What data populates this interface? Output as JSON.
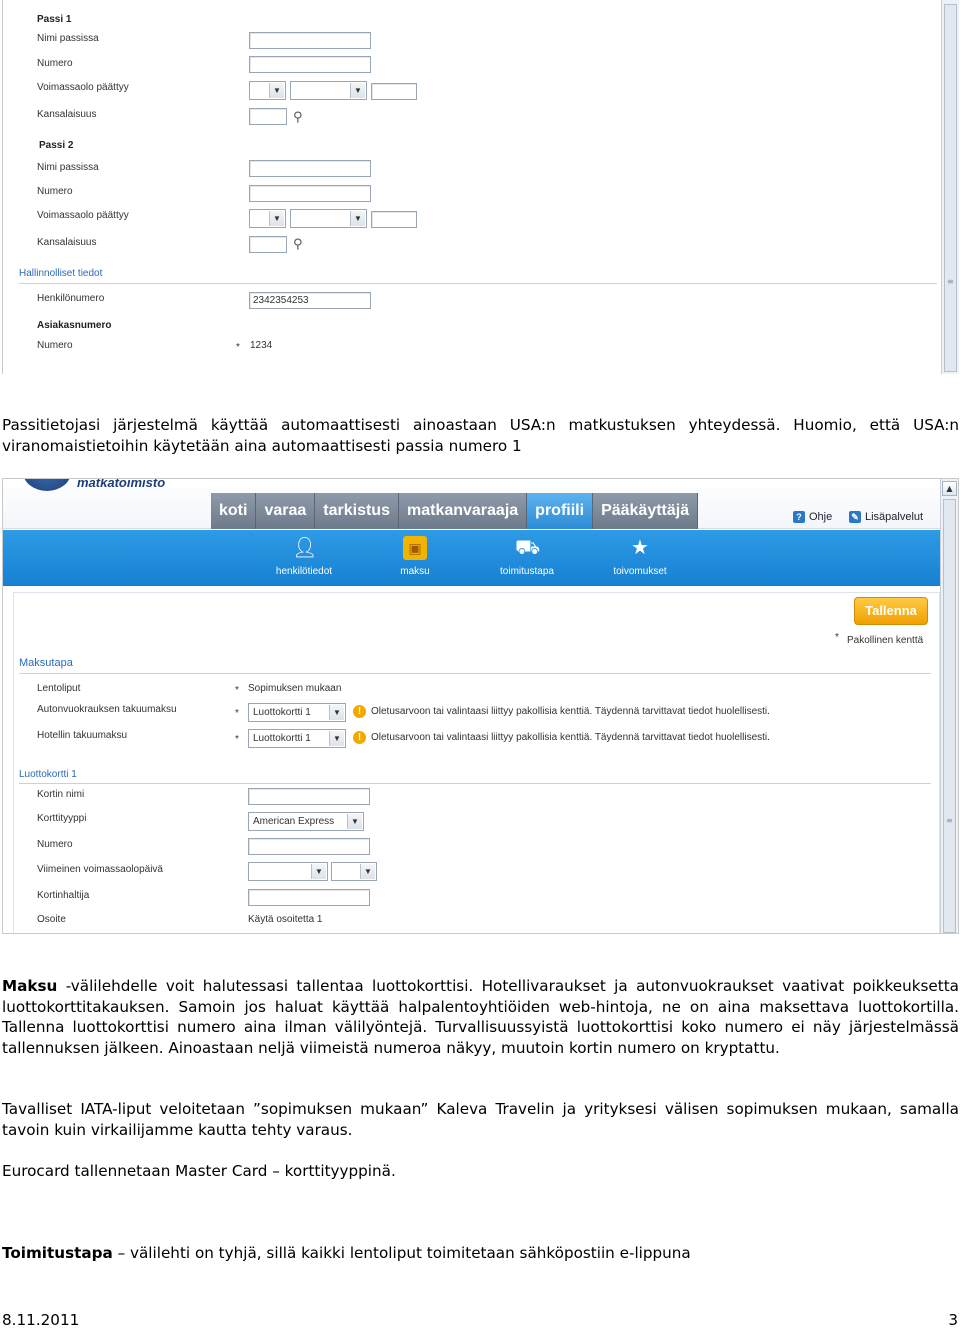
{
  "screenshot1": {
    "passi1": {
      "heading": "Passi 1",
      "name_label": "Nimi passissa",
      "number_label": "Numero",
      "validity_label": "Voimassaolo päättyy",
      "nationality_label": "Kansalaisuus"
    },
    "passi2": {
      "heading": "Passi 2",
      "name_label": "Nimi passissa",
      "number_label": "Numero",
      "validity_label": "Voimassaolo päättyy",
      "nationality_label": "Kansalaisuus"
    },
    "admin": {
      "heading": "Hallinnolliset tiedot",
      "personnel_label": "Henkilönumero",
      "personnel_value": "2342354253",
      "customer_label": "Asiakasnumero",
      "customer_number_label": "Numero",
      "customer_value": "1234",
      "required_mark": "*"
    },
    "icons": {
      "search": "magnifier-icon",
      "dropdown": "chevron-down-icon"
    }
  },
  "paragraph1": "Passitietojasi järjestelmä käyttää automaattisesti ainoastaan USA:n matkustuksen yhteydessä. Huomio, että USA:n viranomaistietoihin käytetään aina automaattisesti passia numero 1",
  "screenshot2": {
    "brand": "matkatoimisto",
    "tabs": [
      "koti",
      "varaa",
      "tarkistus",
      "matkanvaraaja",
      "profiili",
      "Pääkäyttäjä"
    ],
    "active_tab": "profiili",
    "help": "Ohje",
    "extra_services": "Lisäpalvelut",
    "subnav": [
      {
        "label": "henkilötiedot",
        "icon": "person-icon"
      },
      {
        "label": "maksu",
        "icon": "wallet-icon"
      },
      {
        "label": "toimitustapa",
        "icon": "delivery-icon"
      },
      {
        "label": "toivomukset",
        "icon": "star-icon"
      }
    ],
    "save_button": "Tallenna",
    "required_legend": "Pakollinen kenttä",
    "required_mark": "*",
    "maksutapa": {
      "heading": "Maksutapa",
      "flight_label": "Lentoliput",
      "flight_value": "Sopimuksen mukaan",
      "car_label": "Autonvuokrauksen takuumaksu",
      "car_value": "Luottokortti 1",
      "hotel_label": "Hotellin takuumaksu",
      "hotel_value": "Luottokortti 1",
      "warning": "Oletusarvoon tai valintaasi liittyy pakollisia kenttiä. Täydennä tarvittavat tiedot huolellisesti."
    },
    "luottokortti1": {
      "heading": "Luottokortti 1",
      "card_name_label": "Kortin nimi",
      "card_type_label": "Korttityyppi",
      "card_type_value": "American Express",
      "number_label": "Numero",
      "last_valid_label": "Viimeinen voimassaolopäivä",
      "holder_label": "Kortinhaltija",
      "address_label": "Osoite",
      "address_value": "Käytä osoitetta 1"
    }
  },
  "paragraph2": {
    "bold": "Maksu",
    "text": " -välilehdelle voit halutessasi tallentaa luottokorttisi. Hotellivaraukset ja autonvuokraukset vaativat poikkeuksetta luottokorttitakauksen. Samoin jos haluat käyttää halpalentoyhtiöiden web-hintoja, ne on aina maksettava luottokortilla. Tallenna luottokorttisi numero aina ilman välilyöntejä. Turvallisuussyistä luottokorttisi koko numero ei näy järjestelmässä tallennuksen jälkeen. Ainoastaan neljä viimeistä numeroa näkyy, muutoin kortin numero on kryptattu."
  },
  "paragraph3": "Tavalliset IATA-liput veloitetaan ”sopimuksen mukaan” Kaleva Travelin ja yrityksesi välisen sopimuksen mukaan, samalla tavoin kuin virkailijamme kautta tehty varaus.",
  "paragraph4": "Eurocard tallennetaan Master Card – korttityyppinä.",
  "paragraph5": {
    "bold": "Toimitustapa",
    "text": " – välilehti on tyhjä, sillä kaikki lentoliput toimitetaan sähköpostiin e-lippuna"
  },
  "footer": {
    "date": "8.11.2011",
    "page": "3"
  }
}
